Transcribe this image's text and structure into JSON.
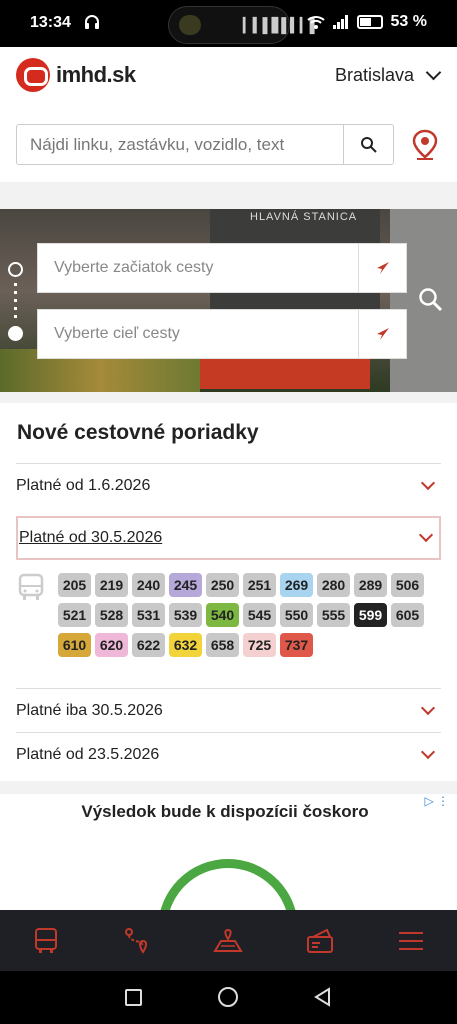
{
  "status_bar": {
    "time": "13:34",
    "battery": "53 %"
  },
  "header": {
    "logo_text": "imhd.sk",
    "city": "Bratislava",
    "search_placeholder": "Nájdi linku, zastávku, vozidlo, text"
  },
  "route": {
    "from_placeholder": "Vyberte začiatok cesty",
    "to_placeholder": "Vyberte cieľ cesty",
    "banner_sign": "HLAVNÁ STANICA"
  },
  "timetables": {
    "title": "Nové cestovné poriadky",
    "rows": [
      {
        "label": "Platné od 1.6.2026"
      },
      {
        "label": "Platné od 30.5.2026"
      },
      {
        "label": "Platné iba 30.5.2026"
      },
      {
        "label": "Platné od 23.5.2026"
      }
    ],
    "lines": [
      {
        "number": "205",
        "color": "#c8c8c8",
        "text_color": "#222222"
      },
      {
        "number": "219",
        "color": "#c8c8c8",
        "text_color": "#222222"
      },
      {
        "number": "240",
        "color": "#c8c8c8",
        "text_color": "#222222"
      },
      {
        "number": "245",
        "color": "#b6a8d8",
        "text_color": "#222222"
      },
      {
        "number": "250",
        "color": "#c8c8c8",
        "text_color": "#222222"
      },
      {
        "number": "251",
        "color": "#c8c8c8",
        "text_color": "#222222"
      },
      {
        "number": "269",
        "color": "#a8d4f0",
        "text_color": "#222222"
      },
      {
        "number": "280",
        "color": "#c8c8c8",
        "text_color": "#222222"
      },
      {
        "number": "289",
        "color": "#c8c8c8",
        "text_color": "#222222"
      },
      {
        "number": "506",
        "color": "#c8c8c8",
        "text_color": "#222222"
      },
      {
        "number": "521",
        "color": "#c8c8c8",
        "text_color": "#222222"
      },
      {
        "number": "528",
        "color": "#c8c8c8",
        "text_color": "#222222"
      },
      {
        "number": "531",
        "color": "#c8c8c8",
        "text_color": "#222222"
      },
      {
        "number": "539",
        "color": "#c8c8c8",
        "text_color": "#222222"
      },
      {
        "number": "540",
        "color": "#7cb842",
        "text_color": "#222222"
      },
      {
        "number": "545",
        "color": "#c8c8c8",
        "text_color": "#222222"
      },
      {
        "number": "550",
        "color": "#c8c8c8",
        "text_color": "#222222"
      },
      {
        "number": "555",
        "color": "#c8c8c8",
        "text_color": "#222222"
      },
      {
        "number": "599",
        "color": "#222222",
        "text_color": "#ffffff"
      },
      {
        "number": "605",
        "color": "#c8c8c8",
        "text_color": "#222222"
      },
      {
        "number": "610",
        "color": "#d6a83a",
        "text_color": "#222222"
      },
      {
        "number": "620",
        "color": "#f0b8d8",
        "text_color": "#222222"
      },
      {
        "number": "622",
        "color": "#c8c8c8",
        "text_color": "#222222"
      },
      {
        "number": "632",
        "color": "#f2d43a",
        "text_color": "#222222"
      },
      {
        "number": "658",
        "color": "#c8c8c8",
        "text_color": "#222222"
      },
      {
        "number": "725",
        "color": "#f4d0d0",
        "text_color": "#222222"
      },
      {
        "number": "737",
        "color": "#e0584a",
        "text_color": "#222222"
      }
    ]
  },
  "ad": {
    "text": "Výsledok bude k dispozícii čoskoro"
  },
  "bottom_nav": {
    "items": [
      "bus-icon",
      "route-icon",
      "map-icon",
      "ticket-icon",
      "menu-icon"
    ],
    "accent": "#c0392b"
  },
  "colors": {
    "brand": "#d52b1e",
    "accent": "#c0392b"
  }
}
